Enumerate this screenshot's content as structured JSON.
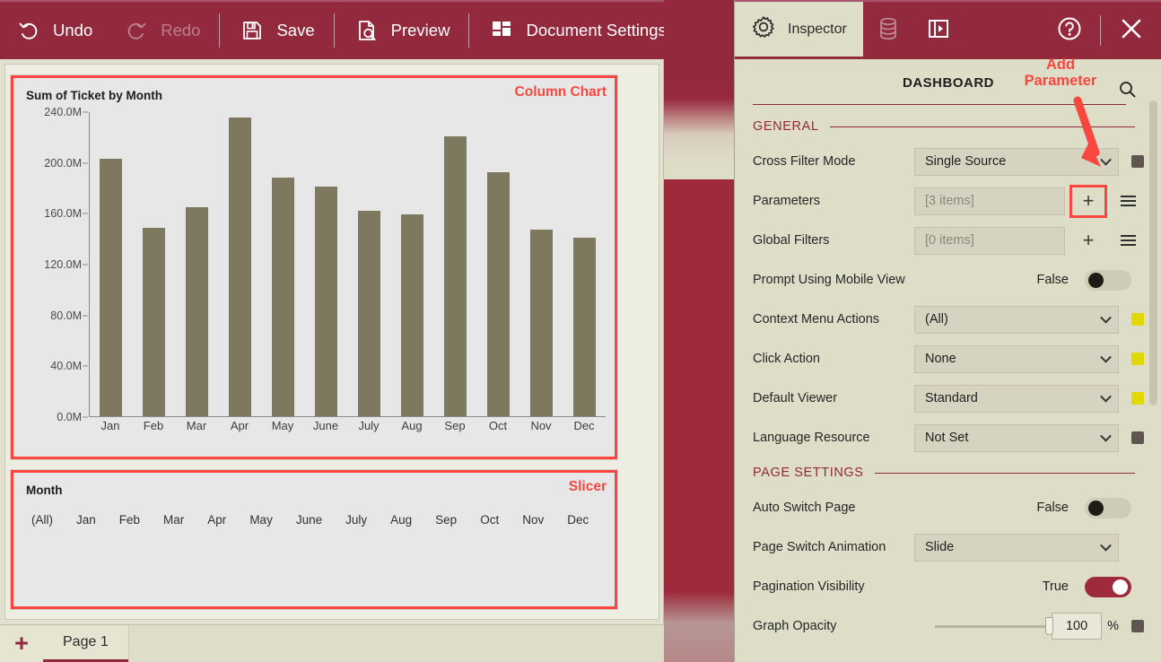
{
  "toolbar": {
    "items": [
      {
        "label": "Undo",
        "icon": "undo-icon",
        "disabled": false
      },
      {
        "label": "Redo",
        "icon": "redo-icon",
        "disabled": true
      },
      {
        "label": "Save",
        "icon": "save-icon",
        "disabled": false
      },
      {
        "label": "Preview",
        "icon": "preview-icon",
        "disabled": false
      },
      {
        "label": "Document Settings",
        "icon": "document-settings-icon",
        "disabled": false
      }
    ]
  },
  "canvas": {
    "chart_widget": {
      "tag": "Column Chart",
      "title": "Sum of Ticket by Month"
    },
    "slicer_widget": {
      "tag": "Slicer",
      "title": "Month",
      "items": [
        "(All)",
        "Jan",
        "Feb",
        "Mar",
        "Apr",
        "May",
        "June",
        "July",
        "Aug",
        "Sep",
        "Oct",
        "Nov",
        "Dec"
      ]
    }
  },
  "chart_data": {
    "type": "bar",
    "title": "Sum of Ticket by Month",
    "xlabel": "",
    "ylabel": "",
    "categories": [
      "Jan",
      "Feb",
      "Mar",
      "Apr",
      "May",
      "June",
      "July",
      "Aug",
      "Sep",
      "Oct",
      "Nov",
      "Dec"
    ],
    "values": [
      202.5,
      148.5,
      164.5,
      235.0,
      187.5,
      180.5,
      161.5,
      158.5,
      220.0,
      192.0,
      146.5,
      140.5
    ],
    "value_unit": "M",
    "ylim": [
      0,
      240
    ],
    "yticks": [
      0,
      40,
      80,
      120,
      160,
      200,
      240
    ],
    "ytick_labels": [
      "0.0M",
      "40.0M",
      "80.0M",
      "120.0M",
      "160.0M",
      "200.0M",
      "240.0M"
    ],
    "grid": false,
    "legend": "none",
    "bar_color": "#7e785f"
  },
  "page_bar": {
    "add_label": "+",
    "tabs": [
      {
        "label": "Page 1",
        "active": true
      }
    ]
  },
  "inspector": {
    "tabs": [
      {
        "label": "Inspector",
        "icon": "gear-icon",
        "active": true
      },
      {
        "label": "",
        "icon": "database-icon",
        "active": false
      },
      {
        "label": "",
        "icon": "panel-expand-icon",
        "active": false
      }
    ],
    "help_icon": "help-circle-icon",
    "close_icon": "close-icon",
    "header_title": "DASHBOARD",
    "search_icon": "search-icon",
    "sections": [
      {
        "name": "GENERAL",
        "rows": [
          {
            "label": "Cross Filter Mode",
            "kind": "select",
            "value": "Single Source",
            "swatch": "dark"
          },
          {
            "label": "Parameters",
            "kind": "items",
            "value": "[3 items]",
            "add_label": "+",
            "menu_icon": "hamburger-icon",
            "highlight": true
          },
          {
            "label": "Global Filters",
            "kind": "items",
            "value": "[0 items]",
            "add_label": "+",
            "menu_icon": "hamburger-icon",
            "highlight": false
          },
          {
            "label": "Prompt Using Mobile View",
            "kind": "toggle",
            "value": "False",
            "on": false
          },
          {
            "label": "Context Menu Actions",
            "kind": "select",
            "value": "(All)",
            "swatch": "yellow"
          },
          {
            "label": "Click Action",
            "kind": "select",
            "value": "None",
            "swatch": "yellow"
          },
          {
            "label": "Default Viewer",
            "kind": "select",
            "value": "Standard",
            "swatch": "yellow"
          },
          {
            "label": "Language Resource",
            "kind": "select",
            "value": "Not Set",
            "swatch": "dark"
          }
        ]
      },
      {
        "name": "PAGE SETTINGS",
        "rows": [
          {
            "label": "Auto Switch Page",
            "kind": "toggle",
            "value": "False",
            "on": false
          },
          {
            "label": "Page Switch Animation",
            "kind": "select-wide",
            "value": "Slide"
          },
          {
            "label": "Pagination Visibility",
            "kind": "toggle",
            "value": "True",
            "on": true
          },
          {
            "label": "Graph Opacity",
            "kind": "slider",
            "value": "100",
            "unit": "%",
            "swatch": "dark"
          }
        ]
      }
    ]
  },
  "annotation": {
    "line1": "Add",
    "line2": "Parameter",
    "color": "#f9463e"
  },
  "colors": {
    "brand": "#93293d",
    "panel_bg": "#deddc8",
    "control_bg": "#d6d4c0",
    "accent_red": "#f9463e",
    "bar": "#7e785f"
  }
}
